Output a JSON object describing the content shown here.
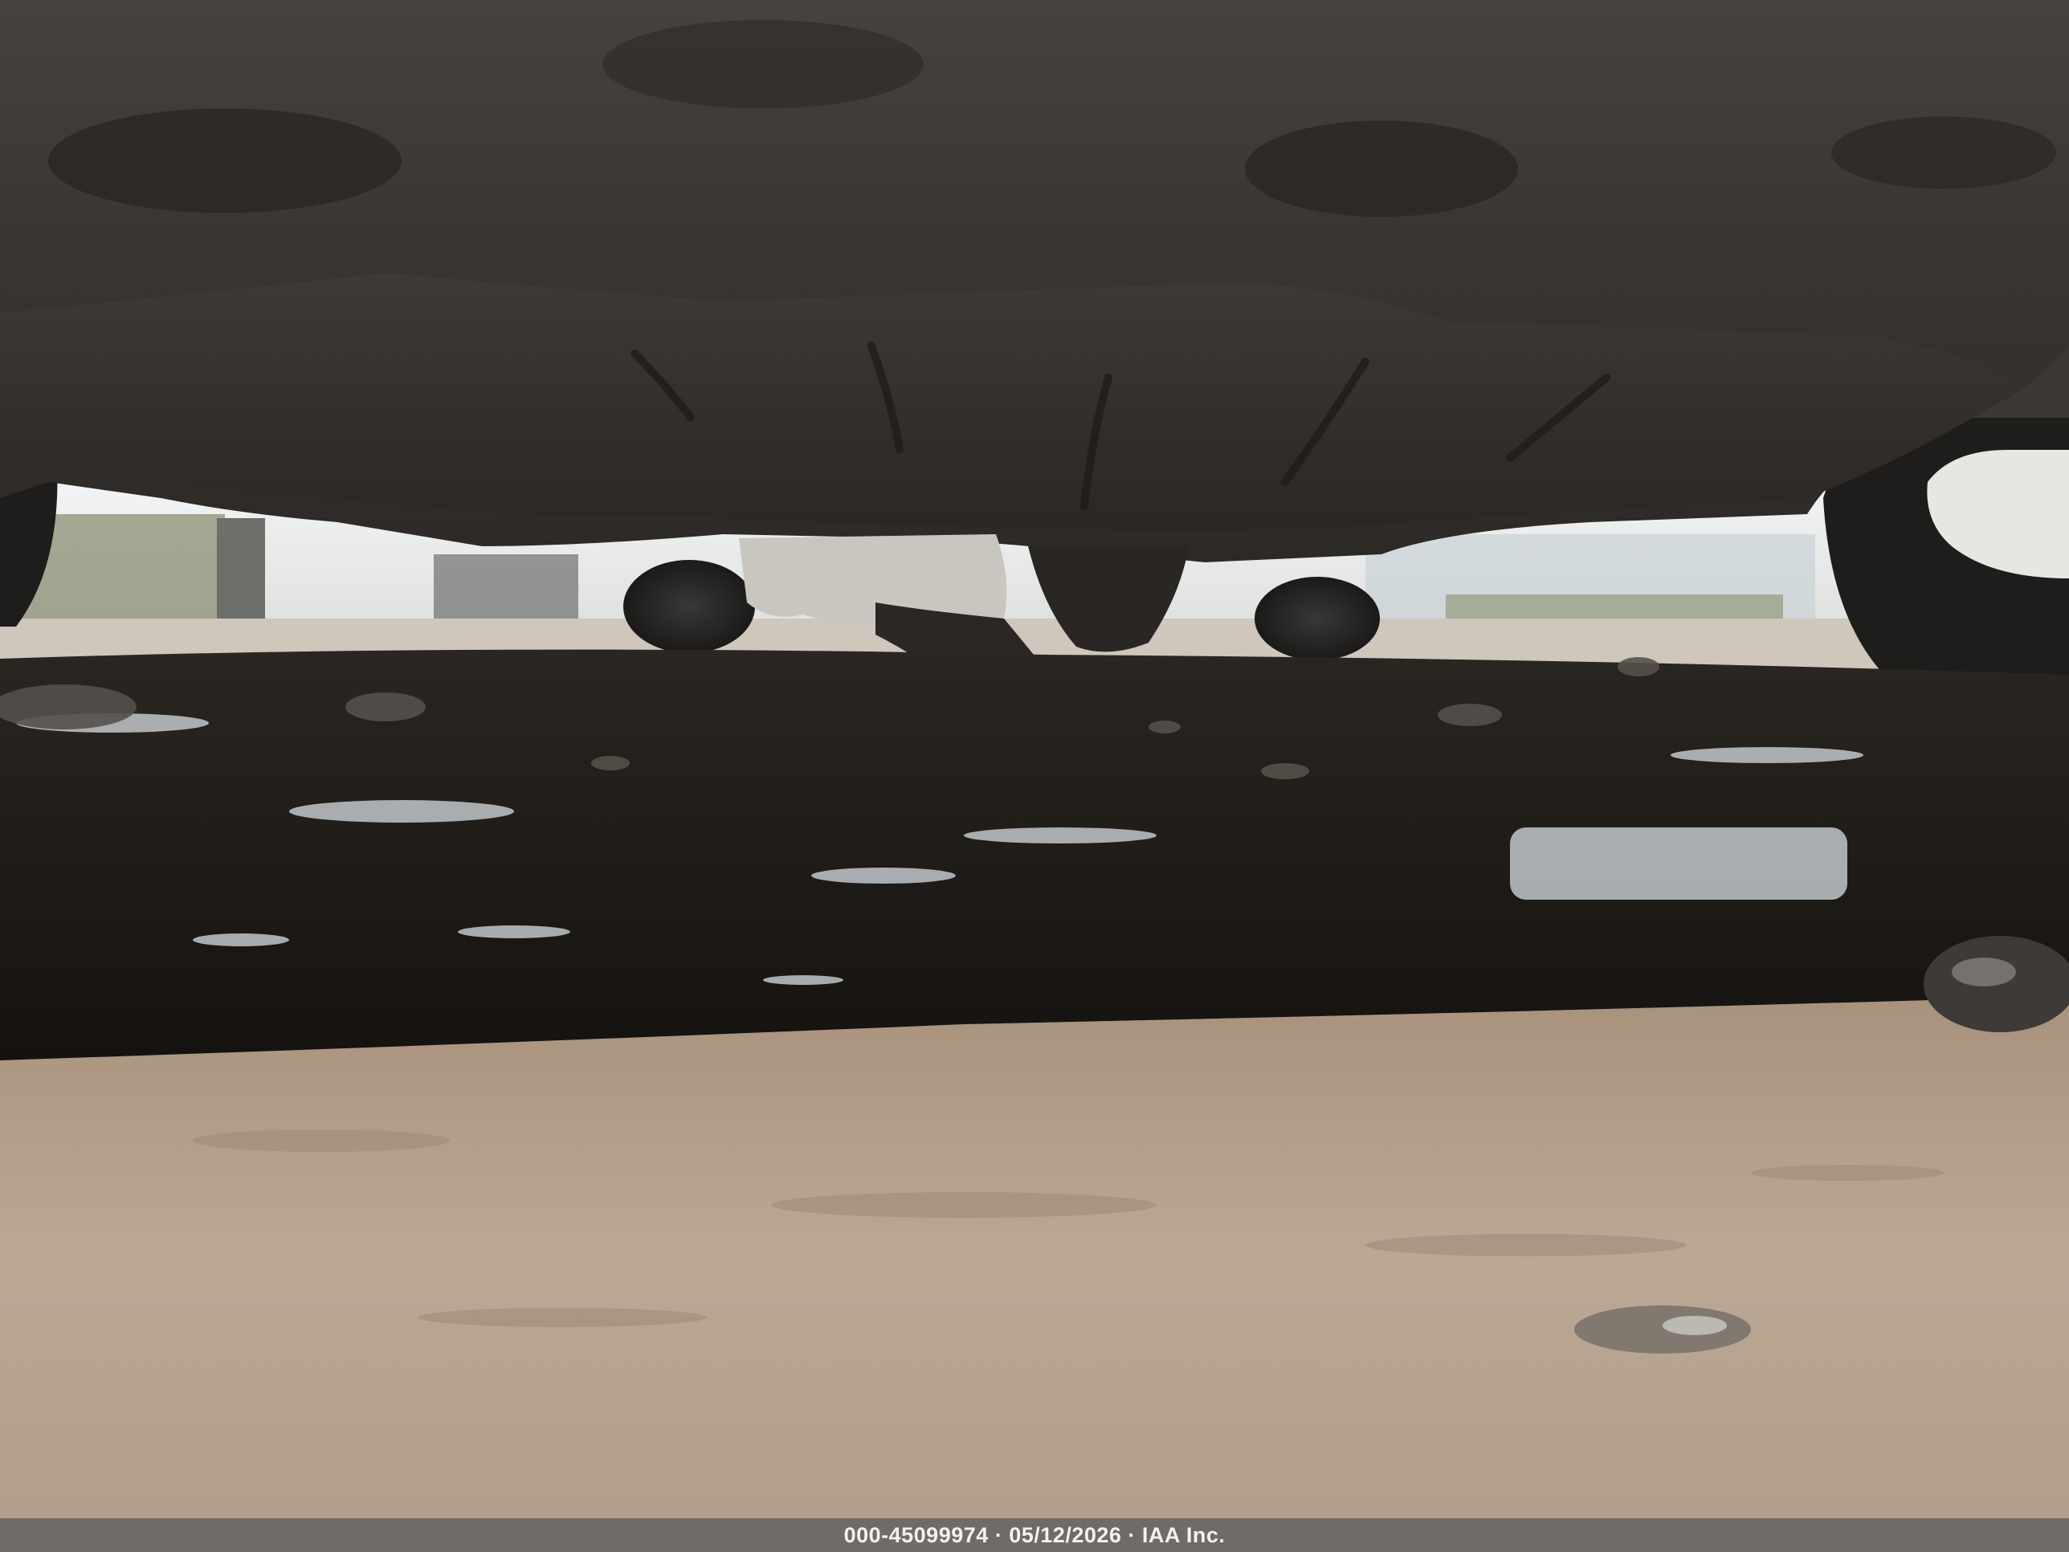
{
  "caption": {
    "text": "000-45099974 · 05/12/2026 · IAA Inc."
  },
  "colors": {
    "undercarriage": "#3a3633",
    "sky": "#eceff0",
    "puddle": "#1d1a17",
    "dirt": "#b8a592",
    "caption_bar": "#6f6b66",
    "caption_text": "#f4f2ee"
  }
}
